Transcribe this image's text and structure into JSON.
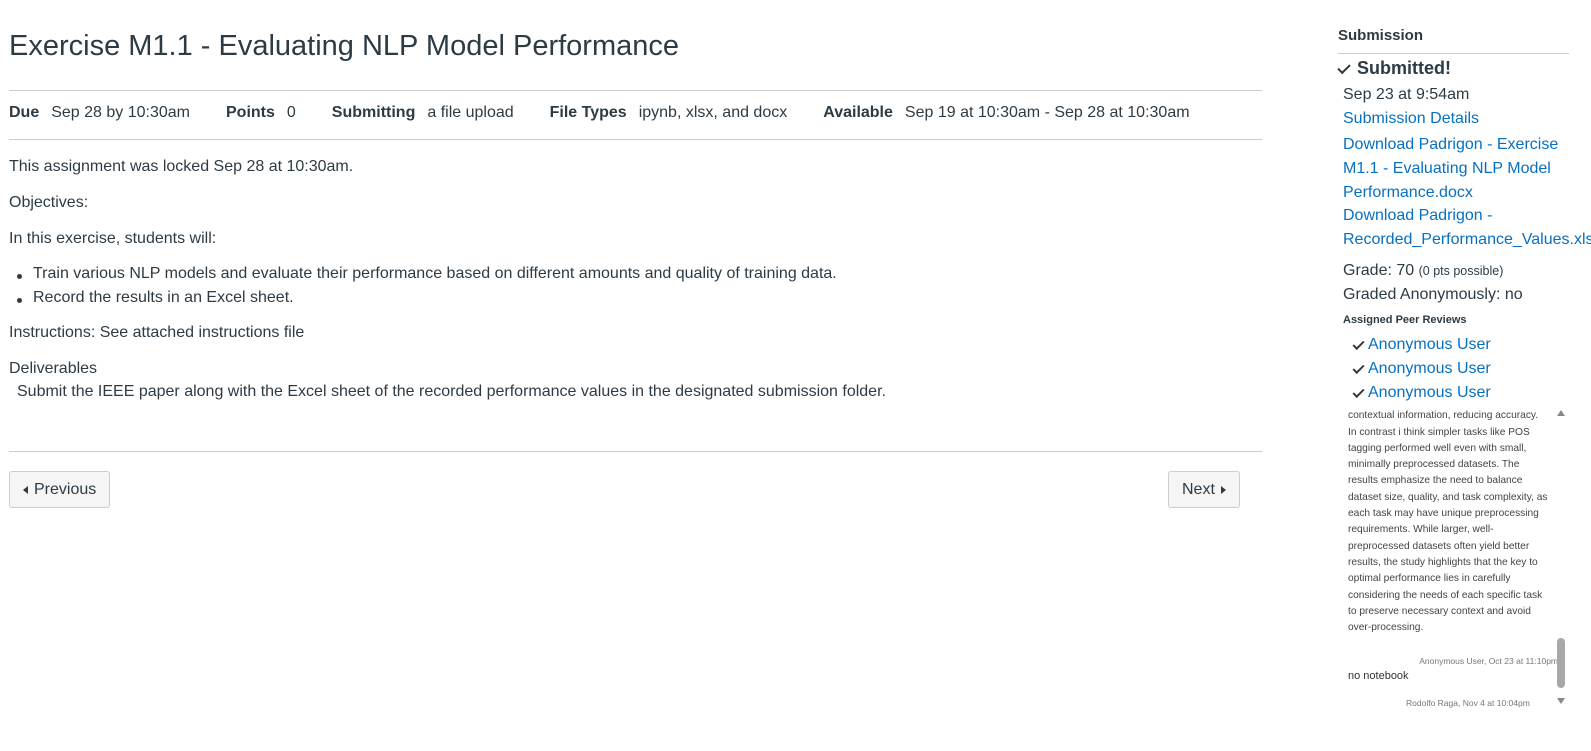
{
  "assignment": {
    "title": "Exercise M1.1 - Evaluating NLP Model Performance",
    "details": {
      "due_label": "Due",
      "due_value": "Sep 28 by 10:30am",
      "points_label": "Points",
      "points_value": "0",
      "submitting_label": "Submitting",
      "submitting_value": "a file upload",
      "filetypes_label": "File Types",
      "filetypes_value": "ipynb, xlsx, and docx",
      "available_label": "Available",
      "available_value": "Sep 19 at 10:30am - Sep 28 at 10:30am"
    },
    "locked_notice": "This assignment was locked Sep 28 at 10:30am.",
    "objectives_label": "Objectives:",
    "intro": "In this exercise, students will:",
    "bullets": [
      "Train various NLP models and evaluate their performance based on different amounts and quality of training data.",
      "Record the results in an Excel sheet."
    ],
    "instructions": "Instructions: See attached instructions file",
    "deliverables_label": "Deliverables",
    "deliverables_text": "Submit the IEEE paper along with the Excel sheet of the recorded performance values in the designated submission folder."
  },
  "navigation": {
    "previous_label": "Previous",
    "next_label": "Next"
  },
  "submission": {
    "heading": "Submission",
    "status": "Submitted!",
    "date": "Sep 23 at 9:54am",
    "details_link": "Submission Details",
    "download1_lines": [
      "Download Padrigon - Exercise",
      "M1.1 - Evaluating NLP Model",
      "Performance.docx"
    ],
    "download2_lines": [
      "Download Padrigon -",
      "Recorded_Performance_Values.xlsx"
    ],
    "grade_label": "Grade: 70",
    "grade_note": "(0 pts possible)",
    "graded_anon": "Graded Anonymously: no",
    "peer_reviews_heading": "Assigned Peer Reviews",
    "peer_reviewers": [
      "Anonymous User",
      "Anonymous User",
      "Anonymous User"
    ]
  },
  "comments": {
    "first_text": "summarization can remove important contextual information, reducing accuracy. In contrast i think simpler tasks like POS tagging performed well even with small, minimally preprocessed datasets. The results emphasize the need to balance dataset size, quality, and task complexity, as each task may have unique preprocessing requirements. While larger, well-preprocessed datasets often yield better results, the study highlights that the key to optimal performance lies in carefully considering the needs of each specific task to preserve necessary context and avoid over-processing.",
    "first_meta": "Anonymous User, Oct 23 at 11:10pm",
    "second_text": "no notebook",
    "second_meta": "Rodolfo Raga, Nov 4 at 10:04pm"
  }
}
